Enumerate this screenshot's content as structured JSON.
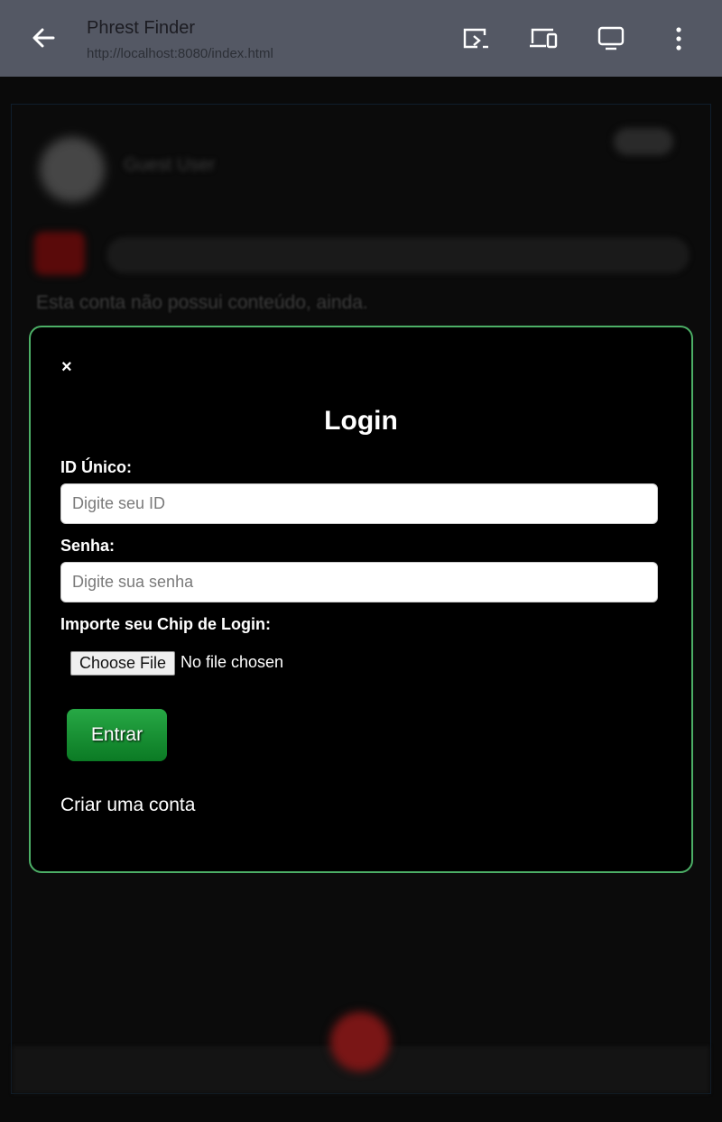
{
  "browser": {
    "title": "Phrest Finder",
    "url": "http://localhost:8080/index.html"
  },
  "background": {
    "username": "Guest User",
    "empty_message": "Esta conta não possui conteúdo, ainda."
  },
  "login": {
    "close_label": "×",
    "title": "Login",
    "id_label": "ID Único:",
    "id_placeholder": "Digite seu ID",
    "password_label": "Senha:",
    "password_placeholder": "Digite sua senha",
    "chip_label": "Importe seu Chip de Login:",
    "file_button": "Choose File",
    "file_status": "No file chosen",
    "submit_label": "Entrar",
    "create_account": "Criar uma conta"
  },
  "colors": {
    "topbar": "#545864",
    "modal_border": "#4caf66",
    "button_green": "#1a9a38"
  }
}
